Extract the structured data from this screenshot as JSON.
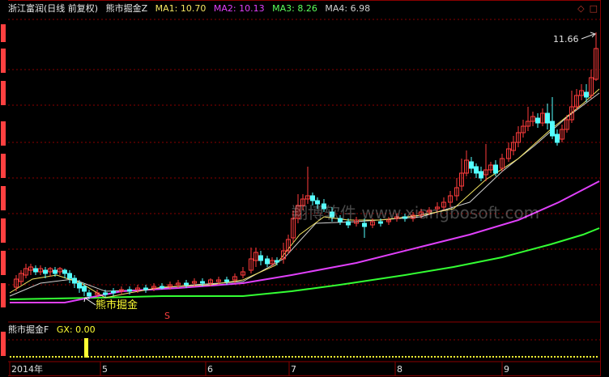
{
  "header": {
    "stock": "浙江富润",
    "period": "(日线 前复权)",
    "indicator": "熊市掘金Z",
    "ma": [
      {
        "label": "MA1:",
        "value": "10.70",
        "color": "#f5e663"
      },
      {
        "label": "MA2:",
        "value": "10.13",
        "color": "#e040fb"
      },
      {
        "label": "MA3:",
        "value": "8.26",
        "color": "#5cff5c"
      },
      {
        "label": "MA4:",
        "value": "6.98",
        "color": "#d0d0d0"
      }
    ]
  },
  "window_icons": [
    "◇",
    "□"
  ],
  "price_annotation": "11.66",
  "signal_label": "熊市掘金",
  "signal_marker": "S",
  "watermark": "翔博软件  www.xiangbosoft.com",
  "sub_panel": {
    "title": "熊市掘金F",
    "gx_label": "GX:",
    "gx_value": "0.00"
  },
  "x_axis": {
    "labels": [
      "2014年",
      "5",
      "6",
      "7",
      "8",
      "9"
    ]
  },
  "colors": {
    "up": "#ff3c3c",
    "down": "#54ffff",
    "grid": "#8b0000",
    "text_red": "#ff4040",
    "label_white": "#e8e8e8",
    "yellow": "#ffff33"
  },
  "chart_data": {
    "type": "candlestick",
    "title": "",
    "ma_series": [
      {
        "name": "MA1",
        "last": 10.7
      },
      {
        "name": "MA2",
        "last": 10.13
      },
      {
        "name": "MA3",
        "last": 8.26
      },
      {
        "name": "MA4",
        "last": 6.98
      }
    ],
    "high_marker": 11.66,
    "sub_indicator": {
      "name": "GX",
      "value": 0.0
    }
  }
}
